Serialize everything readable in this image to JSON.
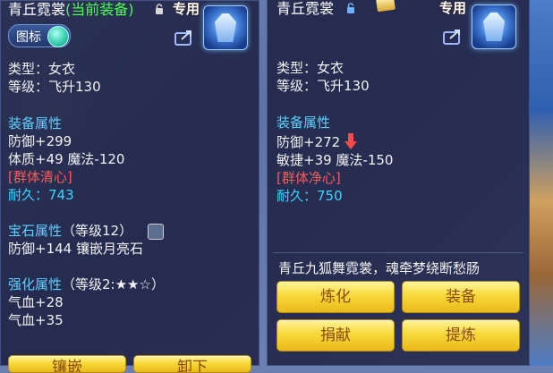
{
  "left_panel": {
    "item_name": "青丘霓裳",
    "current_equipped": "(当前装备)",
    "exclusive_tag": "专用",
    "toggle_label": "图标",
    "type_line": "类型：女衣",
    "level_line": "等级：飞升130",
    "attr_header": "装备属性",
    "attr_lines": [
      "防御+299",
      "体质+49 魔法-120"
    ],
    "special": "[群体清心]",
    "durability_label": "耐久：",
    "durability_value": "743",
    "gem_header": "宝石属性",
    "gem_level": "（等级12）",
    "gem_line": "防御+144 镶嵌月亮石",
    "enhance_header": "强化属性",
    "enhance_level": "（等级2:★★☆）",
    "enhance_lines": [
      "气血+28",
      "气血+35"
    ],
    "bottom_buttons": [
      "镶嵌",
      "卸下"
    ]
  },
  "right_panel": {
    "item_name": "青丘霓裳",
    "exclusive_tag": "专用",
    "type_line": "类型：女衣",
    "level_line": "等级：飞升130",
    "attr_header": "装备属性",
    "attr_line_1": "防御+272",
    "attr_line_2": "敏捷+39 魔法-150",
    "special": "[群体净心]",
    "durability_label": "耐久：",
    "durability_value": "750",
    "description": "青丘九狐舞霓裳，魂牵梦绕断愁肠",
    "buttons": [
      "炼化",
      "装备",
      "捐献",
      "提炼"
    ]
  },
  "colors": {
    "section": "#5fd1ff",
    "special": "#ff5a5a",
    "current": "#4dff4d",
    "button": "#f8d93a"
  },
  "icons": [
    "lock-icon",
    "share-icon",
    "equipment-robe-icon",
    "gem-icon",
    "down-arrow-icon",
    "toggle-knob-icon"
  ]
}
